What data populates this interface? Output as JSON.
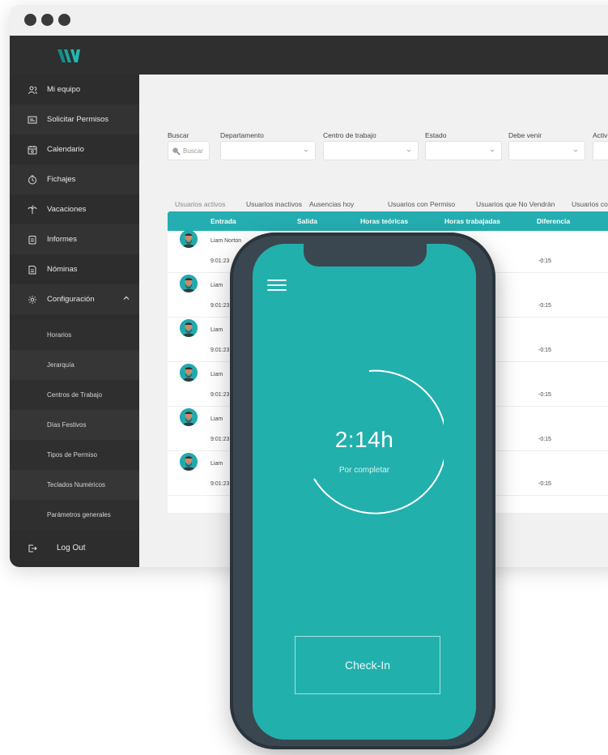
{
  "sidebar": {
    "items": [
      {
        "label": "Mi equipo",
        "icon": "users-icon"
      },
      {
        "label": "Solicitar Permisos",
        "icon": "request-icon"
      },
      {
        "label": "Calendario",
        "icon": "calendar-icon"
      },
      {
        "label": "Fichajes",
        "icon": "clock-icon"
      },
      {
        "label": "Vacaciones",
        "icon": "palm-icon"
      },
      {
        "label": "Informes",
        "icon": "report-icon"
      },
      {
        "label": "Nóminas",
        "icon": "payroll-icon"
      },
      {
        "label": "Configuración",
        "icon": "gear-icon"
      }
    ],
    "sub_items": [
      "Horarios",
      "Jerarquía",
      "Centros de Trabajo",
      "Días Festivos",
      "Tipos de Permiso",
      "Teclados Numéricos",
      "Parámetros generales"
    ],
    "logout": "Log Out"
  },
  "filters": {
    "search_label": "Buscar",
    "search_placeholder": "Buscar",
    "department_label": "Departamento",
    "workcenter_label": "Centro de trabajo",
    "state_label": "Estado",
    "must_come_label": "Debe venir",
    "active_label": "Activ"
  },
  "tabs": [
    "Usuarios activos",
    "Usuarios inactivos",
    "Ausencias hoy",
    "Usuarios con Permiso",
    "Usuarios que No Vendrán",
    "Usuarios co"
  ],
  "table": {
    "headers": [
      "Entrada",
      "Salida",
      "Horas teóricas",
      "Horas trabajadas",
      "Diferencia"
    ],
    "rows": [
      {
        "name": "Liam Norton",
        "time": "9:01:23",
        "diff": "-0:15"
      },
      {
        "name": "Liam",
        "time": "9:01:23",
        "diff": "-0:15"
      },
      {
        "name": "Liam",
        "time": "9:01:23",
        "diff": "-0:15"
      },
      {
        "name": "Liam",
        "time": "9:01:23",
        "diff": "-0:15"
      },
      {
        "name": "Liam",
        "time": "9:01:23",
        "diff": "-0:15"
      },
      {
        "name": "Liam",
        "time": "9:01:23",
        "diff": "-0:15"
      }
    ]
  },
  "phone": {
    "timer": "2:14h",
    "timer_sub": "Por completar",
    "checkin": "Check-In"
  },
  "colors": {
    "accent": "#25aeb1",
    "sidebar": "#2d2d2d",
    "phone_screen": "#22b0ad"
  }
}
